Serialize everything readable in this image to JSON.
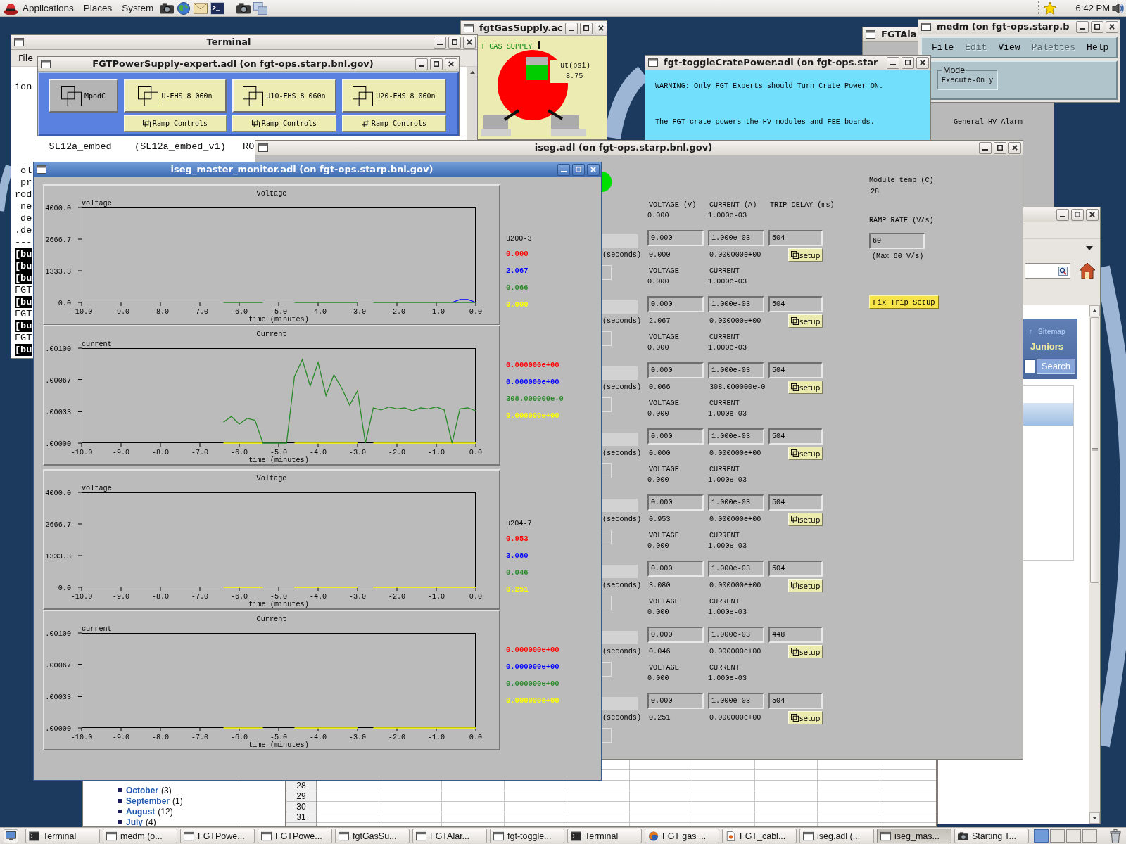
{
  "top_panel": {
    "menus": [
      "Applications",
      "Places",
      "System"
    ],
    "clock": "6:42 PM"
  },
  "terminal_window": {
    "title": "Terminal",
    "menu": [
      "File"
    ],
    "blocks": [
      {
        "lines": [
          {
            "text": "ion",
            "kind": "plain"
          }
        ]
      },
      {
        "lines": [
          {
            "text": "SL12a_embed    (SL12a_embed_v1)   RO",
            "kind": "plain"
          }
        ]
      },
      {
        "lines": [
          {
            "text": " ol",
            "kind": "plain"
          },
          {
            "text": " pr",
            "kind": "plain"
          },
          {
            "text": "rod",
            "kind": "plain"
          },
          {
            "text": " ne",
            "kind": "plain"
          },
          {
            "text": " de",
            "kind": "plain"
          },
          {
            "text": ".de",
            "kind": "plain"
          },
          {
            "text": "---",
            "kind": "plain"
          },
          {
            "text": "[bu",
            "kind": "highlight"
          },
          {
            "text": "[bu",
            "kind": "highlight"
          },
          {
            "text": "[bu",
            "kind": "highlight"
          },
          {
            "text": "FGT",
            "kind": "plain"
          },
          {
            "text": "[bu",
            "kind": "highlight"
          },
          {
            "text": "FGT",
            "kind": "plain"
          },
          {
            "text": "[bu",
            "kind": "highlight"
          },
          {
            "text": "FGT",
            "kind": "plain"
          },
          {
            "text": "[bu",
            "kind": "highlight"
          }
        ]
      }
    ]
  },
  "gas_supply_window": {
    "title": "fgtGasSupply.ac",
    "heading": "T GAS SUPPLY",
    "pressure_label": "ut(psi)",
    "pressure": "8.75",
    "gauge": {
      "level": 0.65
    }
  },
  "power_supply_window": {
    "title": "FGTPowerSupply-expert.adl (on fgt-ops.starp.bnl.gov)",
    "buttons": [
      {
        "label": "MpodC",
        "kind": "crate"
      },
      {
        "label": "U-EHS 8 060n",
        "kind": "module",
        "ramp_button": "Ramp Controls"
      },
      {
        "label": "U10-EHS 8 060n",
        "kind": "module",
        "ramp_button": "Ramp Controls"
      },
      {
        "label": "U20-EHS 8 060n",
        "kind": "module",
        "ramp_button": "Ramp Controls"
      }
    ]
  },
  "alarm_window": {
    "title": "FGTAla",
    "label": "General HV Alarm"
  },
  "medm_window": {
    "title": "medm (on fgt-ops.starp.b",
    "menu": [
      {
        "label": "File",
        "disabled": false
      },
      {
        "label": "Edit",
        "disabled": true
      },
      {
        "label": "View",
        "disabled": false
      },
      {
        "label": "Palettes",
        "disabled": true
      },
      {
        "label": "Help",
        "disabled": false
      }
    ],
    "mode": {
      "label": "Mode",
      "value": "Execute-Only"
    }
  },
  "toggle_window": {
    "title": "fgt-toggleCratePower.adl (on fgt-ops.star",
    "lines": [
      "WARNING: Only FGT Experts should Turn Crate Power ON.",
      "The FGT crate powers the HV modules and FEE boards."
    ]
  },
  "browser_window": {
    "header_links": [
      "r",
      "Sitemap"
    ],
    "heading": "Juniors",
    "search_button": "Search"
  },
  "iseg_window": {
    "title": "iseg.adl (on fgt-ops.starp.bnl.gov)",
    "channels": [
      {
        "labels": [
          "VOLTAGE (V)",
          "CURRENT (A)",
          "TRIP DELAY (ms)"
        ],
        "readback": [
          "0.000",
          "1.000e-03"
        ],
        "settings": [
          "0.000",
          "1.000e-03",
          "504"
        ],
        "unit_label": "(seconds)",
        "measured": [
          "0.000",
          "0.000000e+00"
        ],
        "button": "setup"
      },
      {
        "labels": [
          "VOLTAGE",
          "CURRENT"
        ],
        "readback": [
          "0.000",
          "1.000e-03"
        ],
        "settings": [
          "0.000",
          "1.000e-03",
          "504"
        ],
        "unit_label": "(seconds)",
        "measured": [
          "2.067",
          "0.000000e+00"
        ],
        "button": "setup"
      },
      {
        "labels": [
          "VOLTAGE",
          "CURRENT"
        ],
        "readback": [
          "0.000",
          "1.000e-03"
        ],
        "settings": [
          "0.000",
          "1.000e-03",
          "504"
        ],
        "unit_label": "(seconds)",
        "measured": [
          "0.066",
          "308.000000e-0"
        ],
        "button": "setup"
      },
      {
        "labels": [
          "VOLTAGE",
          "CURRENT"
        ],
        "readback": [
          "0.000",
          "1.000e-03"
        ],
        "settings": [
          "0.000",
          "1.000e-03",
          "504"
        ],
        "unit_label": "(seconds)",
        "measured": [
          "0.000",
          "0.000000e+00"
        ],
        "button": "setup"
      },
      {
        "labels": [
          "VOLTAGE",
          "CURRENT"
        ],
        "readback": [
          "0.000",
          "1.000e-03"
        ],
        "settings": [
          "0.000",
          "1.000e-03",
          "504"
        ],
        "unit_label": "(seconds)",
        "measured": [
          "0.953",
          "0.000000e+00"
        ],
        "button": "setup"
      },
      {
        "labels": [
          "VOLTAGE",
          "CURRENT"
        ],
        "readback": [
          "0.000",
          "1.000e-03"
        ],
        "settings": [
          "0.000",
          "1.000e-03",
          "504"
        ],
        "unit_label": "(seconds)",
        "measured": [
          "3.080",
          "0.000000e+00"
        ],
        "button": "setup"
      },
      {
        "labels": [
          "VOLTAGE",
          "CURRENT"
        ],
        "readback": [
          "0.000",
          "1.000e-03"
        ],
        "settings": [
          "0.000",
          "1.000e-03",
          "448"
        ],
        "unit_label": "(seconds)",
        "measured": [
          "0.046",
          "0.000000e+00"
        ],
        "button": "setup"
      },
      {
        "labels": [
          "VOLTAGE",
          "CURRENT"
        ],
        "readback": [
          "0.000",
          "1.000e-03"
        ],
        "settings": [
          "0.000",
          "1.000e-03",
          "504"
        ],
        "unit_label": "(seconds)",
        "measured": [
          "0.251",
          "0.000000e+00"
        ],
        "button": "setup"
      }
    ],
    "module_temp_label": "Module temp (C)",
    "module_temp": "28",
    "ramp_rate_label": "RAMP RATE (V/s)",
    "ramp_rate": "60",
    "ramp_rate_note": "(Max 60 V/s)",
    "fix_button": "Fix Trip Setup"
  },
  "monitor_window": {
    "title": "iseg_master_monitor.adl (on fgt-ops.starp.bnl.gov)",
    "panels": [
      {
        "chart_data": {
          "type": "line",
          "title": "Voltage",
          "xlabel": "time (minutes)",
          "ylabel": "voltage",
          "x": [
            -6.4,
            -6.2,
            -6,
            -5.8,
            -5.6,
            -5.4,
            -4.6,
            -4.4,
            -4.2,
            -4,
            -3.8,
            -3.6,
            -3.4,
            -3.2,
            -3,
            -2.6,
            -2.4,
            -2.2,
            -2,
            -1.8,
            -1.6,
            -1.4,
            -1.2,
            -1,
            -0.8,
            -0.6,
            -0.4,
            -0.2,
            0
          ],
          "series": [
            {
              "color": "#2a8a2a",
              "values": [
                0,
                0,
                0,
                0,
                0,
                0,
                0,
                0,
                0,
                0,
                0,
                0,
                0,
                0,
                0,
                0,
                0,
                0,
                0,
                0,
                0,
                0,
                0,
                0,
                0,
                0,
                0,
                0,
                0
              ]
            },
            {
              "color": "#0000ff",
              "values": [
                null,
                null,
                null,
                null,
                null,
                null,
                null,
                null,
                null,
                null,
                null,
                null,
                null,
                null,
                null,
                null,
                null,
                null,
                null,
                null,
                null,
                null,
                null,
                null,
                null,
                0,
                120,
                120,
                0
              ]
            }
          ],
          "xlim": [
            -10,
            0
          ],
          "ylim": [
            0,
            4000
          ],
          "xticks": [
            {
              "value": -10,
              "label": "-10.0"
            },
            {
              "value": -9,
              "label": "-9.0"
            },
            {
              "value": -8,
              "label": "-8.0"
            },
            {
              "value": -7,
              "label": "-7.0"
            },
            {
              "value": -6,
              "label": "-6.0"
            },
            {
              "value": -5,
              "label": "-5.0"
            },
            {
              "value": -4,
              "label": "-4.0"
            },
            {
              "value": -3,
              "label": "-3.0"
            },
            {
              "value": -2,
              "label": "-2.0"
            },
            {
              "value": -1,
              "label": "-1.0"
            },
            {
              "value": 0,
              "label": "0.0"
            }
          ],
          "yticks": [
            {
              "value": 0,
              "label": "0.0"
            },
            {
              "value": 1333.3,
              "label": "1333.3"
            },
            {
              "value": 2666.7,
              "label": "2666.7"
            },
            {
              "value": 4000,
              "label": "4000.0"
            }
          ]
        },
        "legend": {
          "heading": "u200-3",
          "values": [
            {
              "text": "0.000",
              "color": "#ff0000"
            },
            {
              "text": "2.067",
              "color": "#0000ff"
            },
            {
              "text": "0.066",
              "color": "#2a8a2a"
            },
            {
              "text": "0.000",
              "color": "#ffff00"
            }
          ]
        }
      },
      {
        "chart_data": {
          "type": "line",
          "title": "Current",
          "xlabel": "time (minutes)",
          "ylabel": "current",
          "x": [
            -6.4,
            -6.2,
            -6,
            -5.8,
            -5.6,
            -5.4,
            -5.2,
            -5,
            -4.8,
            -4.6,
            -4.4,
            -4.2,
            -4,
            -3.8,
            -3.6,
            -3.4,
            -3.2,
            -3,
            -2.8,
            -2.6,
            -2.4,
            -2.2,
            -2,
            -1.8,
            -1.6,
            -1.4,
            -1.2,
            -1,
            -0.8,
            -0.6,
            -0.4,
            -0.2,
            0
          ],
          "series": [
            {
              "color": "#ffff00",
              "values": [
                0,
                0,
                0,
                0,
                0,
                0,
                null,
                null,
                null,
                0,
                0,
                0,
                0,
                0,
                0,
                0,
                0,
                0,
                null,
                0,
                0,
                0,
                0,
                0,
                0,
                0,
                0,
                0,
                0,
                0,
                0,
                0,
                0
              ]
            },
            {
              "color": "#2a8a2a",
              "values": [
                0.00022,
                0.00028,
                0.0002,
                0.00026,
                0.00024,
                0,
                0,
                0,
                0,
                0.0007,
                0.00088,
                0.0006,
                0.00085,
                0.0005,
                0.00072,
                0.00058,
                0.0004,
                0.00055,
                0,
                0.00037,
                0.00035,
                0.00038,
                0.00036,
                0.00037,
                0.00034,
                0.00037,
                0.00036,
                0.00038,
                0.00035,
                0,
                0.00036,
                0.00037,
                0.00034
              ]
            }
          ],
          "xlim": [
            -10,
            0
          ],
          "ylim": [
            0,
            0.001
          ],
          "xticks": [
            {
              "value": -10,
              "label": "-10.0"
            },
            {
              "value": -9,
              "label": "-9.0"
            },
            {
              "value": -8,
              "label": "-8.0"
            },
            {
              "value": -7,
              "label": "-7.0"
            },
            {
              "value": -6,
              "label": "-6.0"
            },
            {
              "value": -5,
              "label": "-5.0"
            },
            {
              "value": -4,
              "label": "-4.0"
            },
            {
              "value": -3,
              "label": "-3.0"
            },
            {
              "value": -2,
              "label": "-2.0"
            },
            {
              "value": -1,
              "label": "-1.0"
            },
            {
              "value": 0,
              "label": "0.0"
            }
          ],
          "yticks": [
            {
              "value": 0,
              "label": ".00000"
            },
            {
              "value": 0.00033,
              "label": ".00033"
            },
            {
              "value": 0.00067,
              "label": ".00067"
            },
            {
              "value": 0.001,
              "label": ".00100"
            }
          ]
        },
        "legend": {
          "values": [
            {
              "text": "0.000000e+00",
              "color": "#ff0000"
            },
            {
              "text": "0.000000e+00",
              "color": "#0000ff"
            },
            {
              "text": "308.000000e-0",
              "color": "#2a8a2a"
            },
            {
              "text": "0.000000e+00",
              "color": "#ffff00"
            }
          ]
        }
      },
      {
        "chart_data": {
          "type": "line",
          "title": "Voltage",
          "xlabel": "time (minutes)",
          "ylabel": "voltage",
          "x": [
            -6.4,
            -6.2,
            -6,
            -5.8,
            -5.6,
            -5.4,
            -4.6,
            -4.4,
            -4.2,
            -4,
            -3.8,
            -3.6,
            -3.4,
            -3.2,
            -3,
            -2.6,
            -2.4,
            -2.2,
            -2,
            -1.8,
            -1.6,
            -1.4,
            -1.2,
            -1,
            -0.8,
            -0.6,
            -0.4,
            -0.2,
            0
          ],
          "series": [
            {
              "color": "#ffff00",
              "values": [
                0,
                0,
                0,
                0,
                0,
                0,
                0,
                0,
                0,
                0,
                0,
                0,
                0,
                0,
                0,
                0,
                0,
                0,
                0,
                0,
                0,
                0,
                0,
                0,
                0,
                0,
                0,
                0,
                0
              ]
            }
          ],
          "xlim": [
            -10,
            0
          ],
          "ylim": [
            0,
            4000
          ],
          "xticks": [
            {
              "value": -10,
              "label": "-10.0"
            },
            {
              "value": -9,
              "label": "-9.0"
            },
            {
              "value": -8,
              "label": "-8.0"
            },
            {
              "value": -7,
              "label": "-7.0"
            },
            {
              "value": -6,
              "label": "-6.0"
            },
            {
              "value": -5,
              "label": "-5.0"
            },
            {
              "value": -4,
              "label": "-4.0"
            },
            {
              "value": -3,
              "label": "-3.0"
            },
            {
              "value": -2,
              "label": "-2.0"
            },
            {
              "value": -1,
              "label": "-1.0"
            },
            {
              "value": 0,
              "label": "0.0"
            }
          ],
          "yticks": [
            {
              "value": 0,
              "label": "0.0"
            },
            {
              "value": 1333.3,
              "label": "1333.3"
            },
            {
              "value": 2666.7,
              "label": "2666.7"
            },
            {
              "value": 4000,
              "label": "4000.0"
            }
          ]
        },
        "legend": {
          "heading": "u204-7",
          "values": [
            {
              "text": "0.953",
              "color": "#ff0000"
            },
            {
              "text": "3.080",
              "color": "#0000ff"
            },
            {
              "text": "0.046",
              "color": "#2a8a2a"
            },
            {
              "text": "0.251",
              "color": "#ffff00"
            }
          ]
        }
      },
      {
        "chart_data": {
          "type": "line",
          "title": "Current",
          "xlabel": "time (minutes)",
          "ylabel": "current",
          "x": [
            -6.4,
            -6.2,
            -6,
            -5.8,
            -5.6,
            -5.4,
            -4.6,
            -4.4,
            -4.2,
            -4,
            -3.8,
            -3.6,
            -3.4,
            -3.2,
            -3,
            -2.6,
            -2.4,
            -2.2,
            -2,
            -1.8,
            -1.6,
            -1.4,
            -1.2,
            -1,
            -0.8,
            -0.6,
            -0.4,
            -0.2,
            0
          ],
          "series": [
            {
              "color": "#ffff00",
              "values": [
                0,
                0,
                0,
                0,
                0,
                0,
                0,
                0,
                0,
                0,
                0,
                0,
                0,
                0,
                0,
                0,
                0,
                0,
                0,
                0,
                0,
                0,
                0,
                0,
                0,
                0,
                0,
                0,
                0
              ]
            }
          ],
          "xlim": [
            -10,
            0
          ],
          "ylim": [
            0,
            0.001
          ],
          "xticks": [
            {
              "value": -10,
              "label": "-10.0"
            },
            {
              "value": -9,
              "label": "-9.0"
            },
            {
              "value": -8,
              "label": "-8.0"
            },
            {
              "value": -7,
              "label": "-7.0"
            },
            {
              "value": -6,
              "label": "-6.0"
            },
            {
              "value": -5,
              "label": "-5.0"
            },
            {
              "value": -4,
              "label": "-4.0"
            },
            {
              "value": -3,
              "label": "-3.0"
            },
            {
              "value": -2,
              "label": "-2.0"
            },
            {
              "value": -1,
              "label": "-1.0"
            },
            {
              "value": 0,
              "label": "0.0"
            }
          ],
          "yticks": [
            {
              "value": 0,
              "label": ".00000"
            },
            {
              "value": 0.00033,
              "label": ".00033"
            },
            {
              "value": 0.00067,
              "label": ".00067"
            },
            {
              "value": 0.001,
              "label": ".00100"
            }
          ]
        },
        "legend": {
          "values": [
            {
              "text": "0.000000e+00",
              "color": "#ff0000"
            },
            {
              "text": "0.000000e+00",
              "color": "#0000ff"
            },
            {
              "text": "0.000000e+00",
              "color": "#2a8a2a"
            },
            {
              "text": "0.000000e+00",
              "color": "#ffff00"
            }
          ]
        }
      }
    ]
  },
  "blog_window": {
    "archive": [
      {
        "month": "October",
        "count": "(3)"
      },
      {
        "month": "September",
        "count": "(1)"
      },
      {
        "month": "August",
        "count": "(12)"
      },
      {
        "month": "July",
        "count": "(4)"
      }
    ]
  },
  "spreadsheet_window": {
    "row_numbers": [
      "28",
      "29",
      "30",
      "31"
    ]
  },
  "taskbar": {
    "items": [
      {
        "label": "Terminal",
        "kind": "terminal",
        "selected": false
      },
      {
        "label": "medm (o...",
        "kind": "window",
        "selected": false
      },
      {
        "label": "FGTPowe...",
        "kind": "window",
        "selected": false
      },
      {
        "label": "FGTPowe...",
        "kind": "window",
        "selected": false
      },
      {
        "label": "fgtGasSu...",
        "kind": "window",
        "selected": false
      },
      {
        "label": "FGTAlar...",
        "kind": "window",
        "selected": false
      },
      {
        "label": "fgt-toggle...",
        "kind": "window",
        "selected": false
      },
      {
        "label": "Terminal",
        "kind": "terminal",
        "selected": false
      },
      {
        "label": "FGT gas ...",
        "kind": "browser",
        "selected": false
      },
      {
        "label": "FGT_cabl...",
        "kind": "document",
        "selected": false
      },
      {
        "label": "iseg.adl (...",
        "kind": "window",
        "selected": false
      },
      {
        "label": "iseg_mas...",
        "kind": "window",
        "selected": true
      },
      {
        "label": "Starting T...",
        "kind": "camera",
        "selected": false
      }
    ],
    "workspaces": [
      {
        "selected": true
      },
      {
        "selected": false
      },
      {
        "selected": false
      },
      {
        "selected": false
      }
    ]
  }
}
